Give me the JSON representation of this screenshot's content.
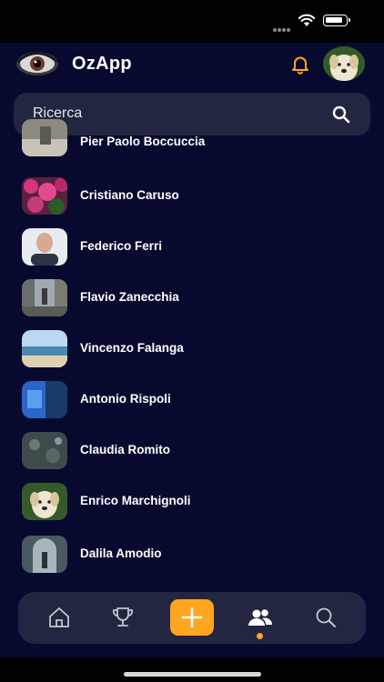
{
  "app": {
    "title": "OzApp"
  },
  "search": {
    "placeholder": "Ricerca"
  },
  "contacts": [
    {
      "name": "Pier Paolo Boccuccia"
    },
    {
      "name": "Cristiano Caruso"
    },
    {
      "name": "Federico Ferri"
    },
    {
      "name": "Flavio Zanecchia"
    },
    {
      "name": "Vincenzo Falanga"
    },
    {
      "name": "Antonio Rispoli"
    },
    {
      "name": "Claudia Romito"
    },
    {
      "name": "Enrico Marchignoli"
    },
    {
      "name": "Dalila Amodio"
    }
  ],
  "tabbar": {
    "items": [
      "home-icon",
      "trophy-icon",
      "plus-icon",
      "people-icon",
      "search-icon"
    ],
    "active": "people-icon"
  },
  "colors": {
    "background": "#070a2e",
    "surface": "#222640",
    "accent": "#ffa51f"
  }
}
